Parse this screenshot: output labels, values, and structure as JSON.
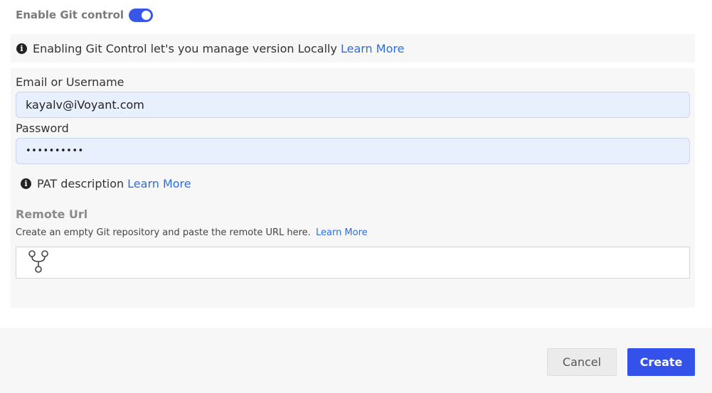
{
  "git_toggle": {
    "label": "Enable Git control",
    "enabled": true
  },
  "info_banner": {
    "icon": "info-icon",
    "text": "Enabling Git Control let's you manage version Locally",
    "link": "Learn More"
  },
  "credentials": {
    "email_label": "Email or Username",
    "email_value": "kayalv@iVoyant.com",
    "password_label": "Password",
    "password_value": "••••••••••"
  },
  "pat": {
    "icon": "info-icon",
    "text": "PAT description",
    "link": "Learn More"
  },
  "remote": {
    "label": "Remote Url",
    "help": "Create an empty Git repository and paste the remote URL here.",
    "help_link": "Learn More",
    "icon": "git-branch-icon",
    "value": ""
  },
  "footer": {
    "cancel_label": "Cancel",
    "create_label": "Create"
  },
  "colors": {
    "accent": "#3452ea",
    "link": "#2b6ee0",
    "input_bg": "#e8effd"
  }
}
